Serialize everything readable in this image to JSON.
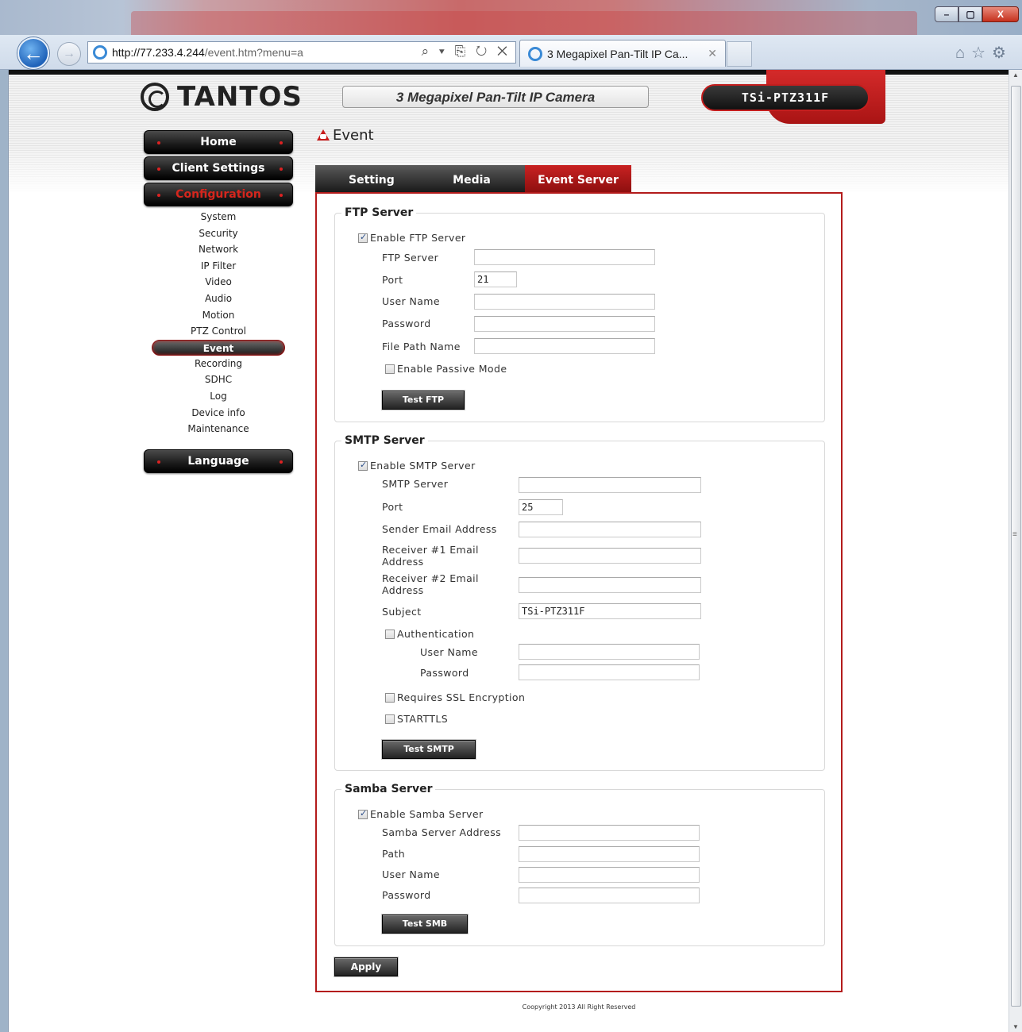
{
  "browser": {
    "url_host": "http://77.233.4.244",
    "url_path": "/event.htm?menu=a",
    "address_tools": "⌕ ▾ ⎘ ↻ ✕",
    "tab_title": "3 Megapixel Pan-Tilt IP Ca...",
    "tab_close": "✕",
    "back_glyph": "←",
    "forward_glyph": "→",
    "window_buttons": {
      "minimize": "–",
      "maximize": "▢",
      "close": "X"
    },
    "right_icons": "⌂☆⚙",
    "icons": [
      "back-arrow-icon",
      "forward-arrow-icon",
      "ie-logo-icon",
      "search-icon",
      "compat-icon",
      "refresh-icon",
      "stop-icon",
      "home-icon",
      "favorites-star-icon",
      "settings-gear-icon"
    ]
  },
  "header": {
    "logo_text": "TANTOS",
    "product_name": "3 Megapixel Pan-Tilt IP Camera",
    "model": "TSi-PTZ311F"
  },
  "sidebar": {
    "home": "Home",
    "client_settings": "Client Settings",
    "configuration": "Configuration",
    "items": [
      "System",
      "Security",
      "Network",
      "IP Filter",
      "Video",
      "Audio",
      "Motion",
      "PTZ Control",
      "Event",
      "Recording",
      "SDHC",
      "Log",
      "Device info",
      "Maintenance"
    ],
    "current_item": "Event",
    "language": "Language"
  },
  "page": {
    "title": "Event",
    "tabs": [
      "Setting",
      "Media",
      "Event Server"
    ],
    "active_tab": "Event Server",
    "apply": "Apply",
    "copyright": "Coopyright 2013 All Right Reserved"
  },
  "ftp": {
    "legend": "FTP Server",
    "enable_label": "Enable FTP Server",
    "enable_checked": true,
    "server_label": "FTP Server",
    "server_value": "",
    "port_label": "Port",
    "port_value": "21",
    "user_label": "User Name",
    "user_value": "",
    "password_label": "Password",
    "password_value": "",
    "path_label": "File Path Name",
    "path_value": "",
    "passive_label": "Enable Passive Mode",
    "passive_checked": false,
    "test_button": "Test FTP"
  },
  "smtp": {
    "legend": "SMTP Server",
    "enable_label": "Enable SMTP Server",
    "enable_checked": true,
    "server_label": "SMTP Server",
    "server_value": "",
    "port_label": "Port",
    "port_value": "25",
    "sender_label": "Sender Email Address",
    "sender_value": "",
    "receiver1_label_l1": "Receiver #1 Email",
    "receiver1_label_l2": "Address",
    "receiver1_value": "",
    "receiver2_label_l1": "Receiver #2 Email",
    "receiver2_label_l2": "Address",
    "receiver2_value": "",
    "subject_label": "Subject",
    "subject_value": "TSi-PTZ311F",
    "auth_label": "Authentication",
    "auth_checked": false,
    "auth_user_label": "User Name",
    "auth_user_value": "",
    "auth_password_label": "Password",
    "auth_password_value": "",
    "ssl_label": "Requires SSL Encryption",
    "ssl_checked": false,
    "starttls_label": "STARTTLS",
    "starttls_checked": false,
    "test_button": "Test SMTP"
  },
  "samba": {
    "legend": "Samba Server",
    "enable_label": "Enable Samba Server",
    "enable_checked": true,
    "address_label": "Samba Server Address",
    "address_value": "",
    "path_label": "Path",
    "path_value": "",
    "user_label": "User Name",
    "user_value": "",
    "password_label": "Password",
    "password_value": "",
    "test_button": "Test SMB"
  },
  "colors": {
    "accent_red": "#b31b1b",
    "button_dark": "#222222",
    "menu_active": "#d5261d"
  }
}
